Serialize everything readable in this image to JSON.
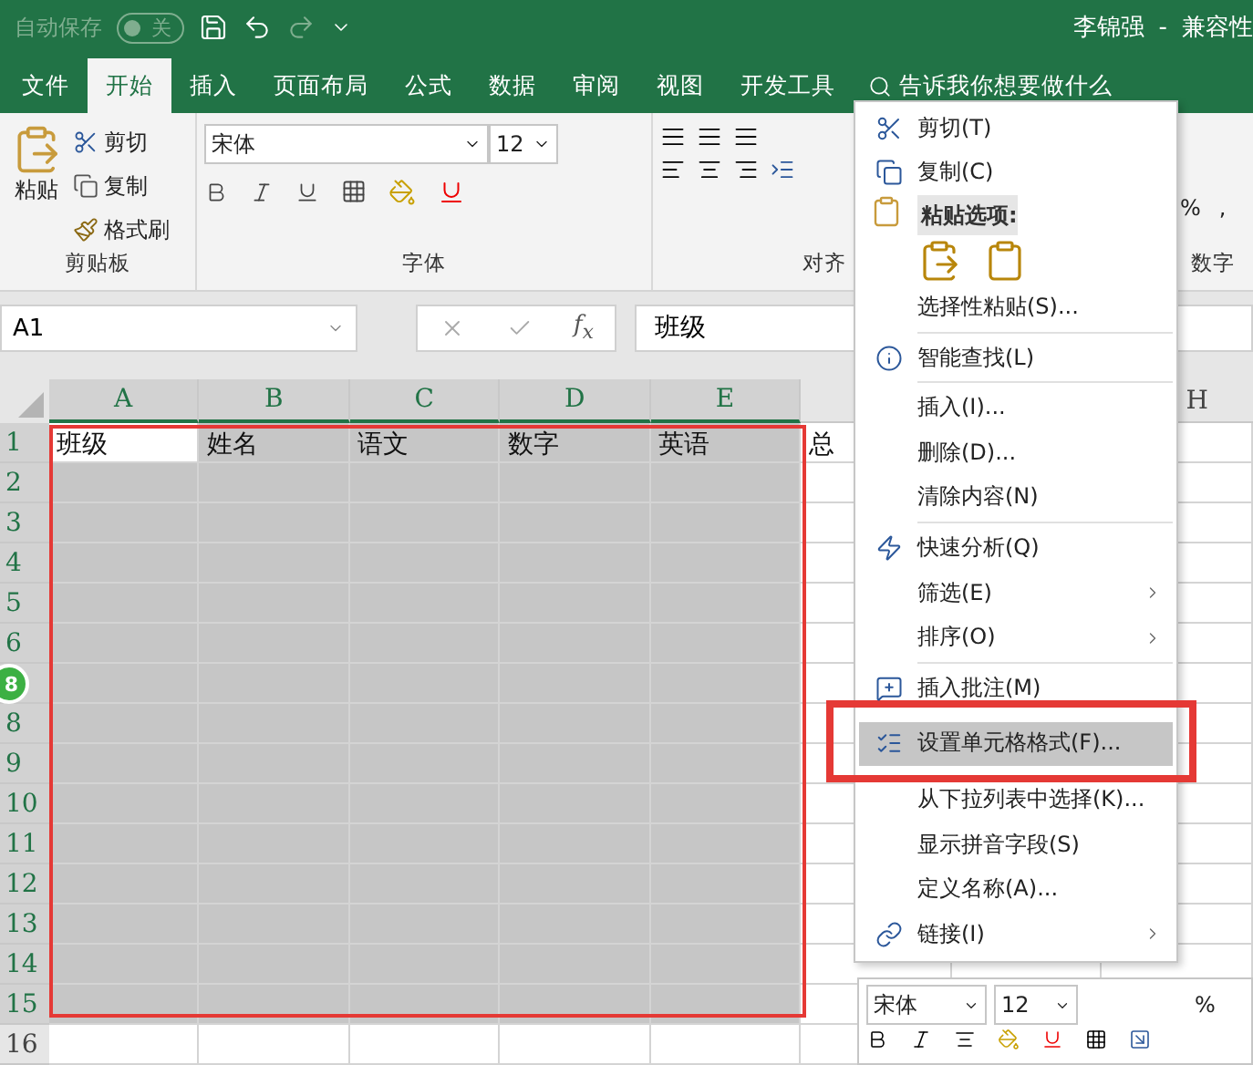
{
  "title_bar": {
    "autosave_label": "自动保存",
    "autosave_toggle": {
      "label": "关",
      "on": false
    },
    "user": "李锦强",
    "separator": "-",
    "doc_title": "兼容性"
  },
  "tabs": [
    {
      "label": "文件",
      "selected": false
    },
    {
      "label": "开始",
      "selected": true
    },
    {
      "label": "插入",
      "selected": false
    },
    {
      "label": "页面布局",
      "selected": false
    },
    {
      "label": "公式",
      "selected": false
    },
    {
      "label": "数据",
      "selected": false
    },
    {
      "label": "审阅",
      "selected": false
    },
    {
      "label": "视图",
      "selected": false
    },
    {
      "label": "开发工具",
      "selected": false
    }
  ],
  "tell_me": {
    "placeholder": "告诉我你想要做什么"
  },
  "ribbon": {
    "clipboard": {
      "paste": "粘贴",
      "cut": "剪切",
      "copy": "复制",
      "format_painter": "格式刷",
      "label": "剪贴板"
    },
    "font": {
      "font_name": "宋体",
      "font_size": "12",
      "label": "字体"
    },
    "alignment": {
      "label": "对齐"
    },
    "number": {
      "percent": "%",
      "comma": ",",
      "label": "数字"
    }
  },
  "formula_bar": {
    "name_box": "A1",
    "function_label": "f$_{x}$",
    "value": "班级"
  },
  "sheet": {
    "columns": [
      {
        "label": "A",
        "selected": true
      },
      {
        "label": "B",
        "selected": true
      },
      {
        "label": "C",
        "selected": true
      },
      {
        "label": "D",
        "selected": true
      },
      {
        "label": "E",
        "selected": true
      }
    ],
    "far_column": "H",
    "outlined": true,
    "rows": [
      {
        "number": "1",
        "selected": true,
        "cells": [
          {
            "text": "班级",
            "active": true
          },
          {
            "text": "姓名",
            "active": false
          },
          {
            "text": "语文",
            "active": false
          },
          {
            "text": "数字",
            "active": false
          },
          {
            "text": "英语",
            "active": false
          }
        ],
        "overflow_text": "总"
      },
      {
        "number": "2",
        "selected": true
      },
      {
        "number": "3",
        "selected": true
      },
      {
        "number": "4",
        "selected": true
      },
      {
        "number": "5",
        "selected": true
      },
      {
        "number": "6",
        "selected": true
      },
      {
        "selected": true
      },
      {
        "number": "8",
        "selected": true
      },
      {
        "number": "9",
        "selected": true
      },
      {
        "number": "10",
        "selected": true
      },
      {
        "number": "11",
        "selected": true
      },
      {
        "number": "12",
        "selected": true
      },
      {
        "number": "13",
        "selected": true
      },
      {
        "number": "14",
        "selected": true
      },
      {
        "number": "15",
        "selected": true
      },
      {
        "number": "16",
        "selected": false
      }
    ]
  },
  "side_badge": "8",
  "context_menu": {
    "items": [
      {
        "kind": "item",
        "label": "剪切(T)",
        "selected": false
      },
      {
        "kind": "item",
        "label": "复制(C)",
        "selected": false
      },
      {
        "kind": "header",
        "label": "粘贴选项:"
      },
      {
        "kind": "paste_icons"
      },
      {
        "kind": "item",
        "label": "选择性粘贴(S)...",
        "selected": false
      },
      {
        "kind": "separator"
      },
      {
        "kind": "item",
        "label": "智能查找(L)",
        "selected": false
      },
      {
        "kind": "separator"
      },
      {
        "kind": "item",
        "label": "插入(I)...",
        "selected": false
      },
      {
        "kind": "item",
        "label": "删除(D)...",
        "selected": false
      },
      {
        "kind": "item",
        "label": "清除内容(N)",
        "selected": false
      },
      {
        "kind": "separator"
      },
      {
        "kind": "item",
        "label": "快速分析(Q)",
        "selected": false
      },
      {
        "kind": "item",
        "label": "筛选(E)",
        "selected": false,
        "submenu": true
      },
      {
        "kind": "item",
        "label": "排序(O)",
        "selected": false,
        "submenu": true
      },
      {
        "kind": "separator"
      },
      {
        "kind": "item",
        "label": "插入批注(M)",
        "selected": false
      },
      {
        "kind": "item",
        "label": "设置单元格格式(F)...",
        "selected": true,
        "annotated": true
      },
      {
        "kind": "item",
        "label": "从下拉列表中选择(K)...",
        "selected": false
      },
      {
        "kind": "item",
        "label": "显示拼音字段(S)",
        "selected": false
      },
      {
        "kind": "item",
        "label": "定义名称(A)...",
        "selected": false
      },
      {
        "kind": "item",
        "label": "链接(I)",
        "selected": false,
        "submenu": true
      }
    ]
  },
  "mini_toolbar": {
    "font_name": "宋体",
    "font_size": "12",
    "percent": "%"
  }
}
